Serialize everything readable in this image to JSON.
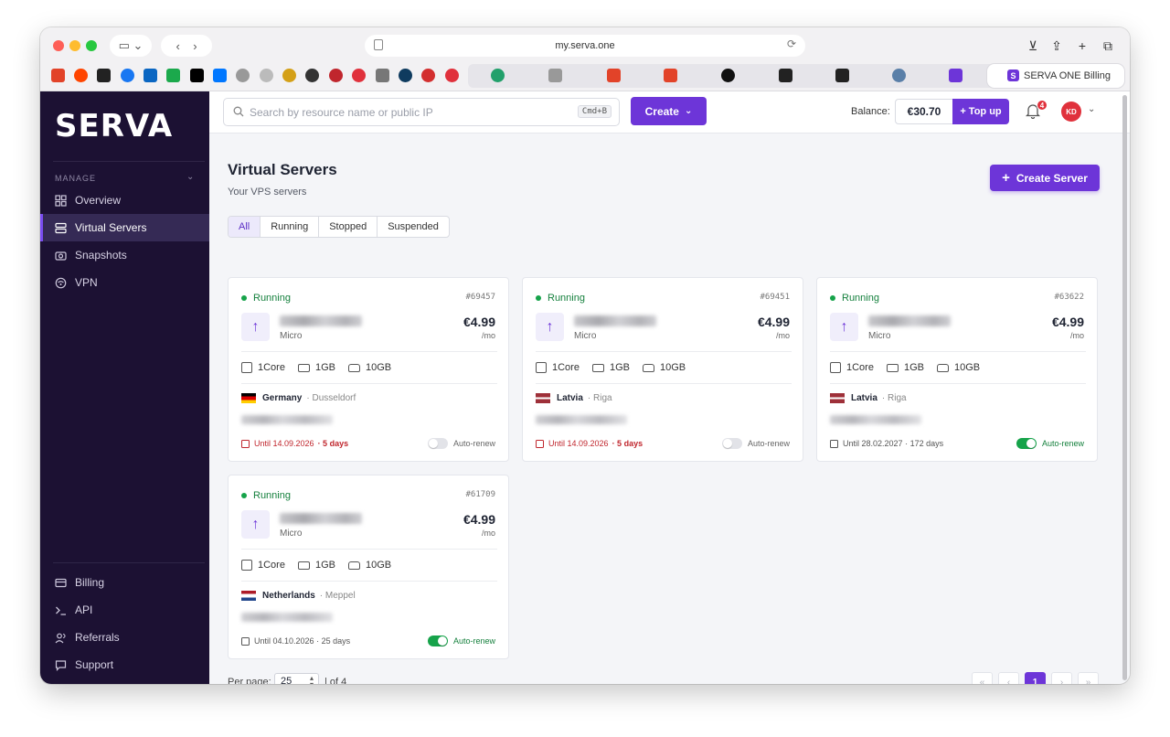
{
  "browser": {
    "url": "my.serva.one",
    "active_tab_title": "SERVA ONE Billing",
    "active_tab_favicon": "S"
  },
  "sidebar": {
    "logo": "SERVA",
    "section_label": "MANAGE",
    "items": [
      {
        "label": "Overview",
        "icon": "grid-icon"
      },
      {
        "label": "Virtual Servers",
        "icon": "server-icon"
      },
      {
        "label": "Snapshots",
        "icon": "camera-icon"
      },
      {
        "label": "VPN",
        "icon": "vpn-icon"
      }
    ],
    "bottom_items": [
      {
        "label": "Billing",
        "icon": "card-icon"
      },
      {
        "label": "API",
        "icon": "terminal-icon"
      },
      {
        "label": "Referrals",
        "icon": "users-icon"
      },
      {
        "label": "Support",
        "icon": "chat-icon"
      }
    ]
  },
  "topbar": {
    "search_placeholder": "Search by resource name or public IP",
    "search_shortcut": "Cmd+B",
    "create_label": "Create",
    "balance_label": "Balance:",
    "balance_value": "€30.70",
    "topup_label": "+ Top up",
    "notification_count": "4",
    "avatar_initials": "KD"
  },
  "page": {
    "title": "Virtual Servers",
    "subtitle": "Your VPS servers",
    "create_server_label": "Create Server",
    "filters": [
      "All",
      "Running",
      "Stopped",
      "Suspended"
    ],
    "active_filter": "All"
  },
  "servers": [
    {
      "status": "Running",
      "id": "#69457",
      "plan": "Micro",
      "price": "€4.99",
      "period": "/mo",
      "cpu": "1Core",
      "ram": "1GB",
      "disk": "10GB",
      "country": "Germany",
      "city": "· Dusseldorf",
      "until": "Until 14.09.2026",
      "remaining": "· 5 days",
      "auto_renew": false,
      "auto_renew_label": "Auto-renew"
    },
    {
      "status": "Running",
      "id": "#69451",
      "plan": "Micro",
      "price": "€4.99",
      "period": "/mo",
      "cpu": "1Core",
      "ram": "1GB",
      "disk": "10GB",
      "country": "Latvia",
      "city": "· Riga",
      "until": "Until 14.09.2026",
      "remaining": "· 5 days",
      "auto_renew": false,
      "auto_renew_label": "Auto-renew"
    },
    {
      "status": "Running",
      "id": "#63622",
      "plan": "Micro",
      "price": "€4.99",
      "period": "/mo",
      "cpu": "1Core",
      "ram": "1GB",
      "disk": "10GB",
      "country": "Latvia",
      "city": "· Riga",
      "until": "Until 28.02.2027",
      "remaining": "· 172 days",
      "auto_renew": true,
      "auto_renew_label": "Auto-renew"
    },
    {
      "status": "Running",
      "id": "#61709",
      "plan": "Micro",
      "price": "€4.99",
      "period": "/mo",
      "cpu": "1Core",
      "ram": "1GB",
      "disk": "10GB",
      "country": "Netherlands",
      "city": "· Meppel",
      "until": "Until 04.10.2026",
      "remaining": "· 25 days",
      "auto_renew": true,
      "auto_renew_label": "Auto-renew"
    }
  ],
  "pagination": {
    "per_page_label": "Per page:",
    "per_page_value": "25",
    "of_pages": "| of 4",
    "current_page": "1",
    "first": "«",
    "prev": "‹",
    "next": "›",
    "last": "»"
  },
  "colors": {
    "accent": "#6d35d8",
    "sidebar_bg": "#1c1133",
    "running_green": "#16a34a",
    "warning_red": "#c0262d"
  }
}
